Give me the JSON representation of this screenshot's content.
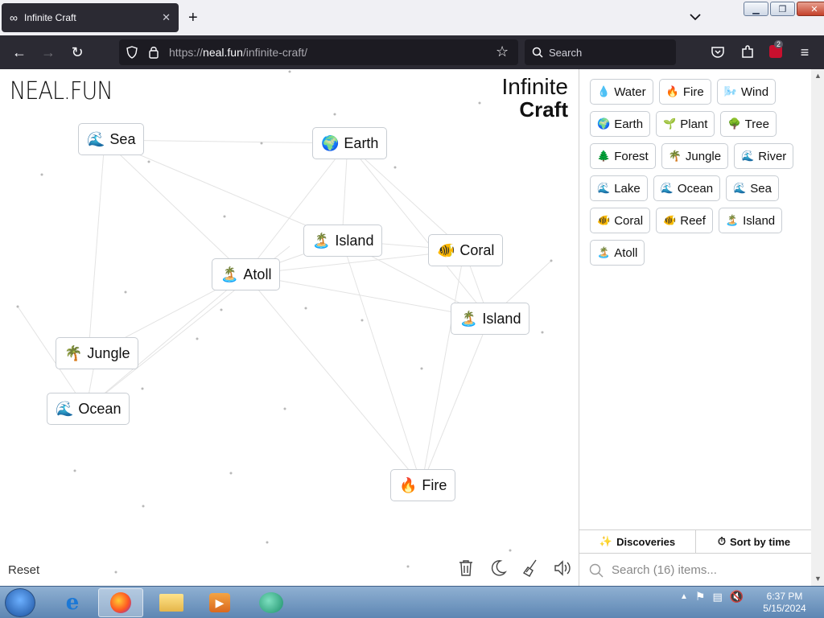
{
  "browser": {
    "tab_title": "Infinite Craft",
    "url_prefix": "https://",
    "url_domain": "neal.fun",
    "url_path": "/infinite-craft/",
    "search_placeholder": "Search",
    "extension_badge": "2"
  },
  "page": {
    "logo": "NEAL.FUN",
    "title_line1": "Infinite",
    "title_line2": "Craft",
    "reset_label": "Reset"
  },
  "canvas_items": [
    {
      "emoji": "🌊",
      "label": "Sea"
    },
    {
      "emoji": "🌍",
      "label": "Earth"
    },
    {
      "emoji": "🏝️",
      "label": "Island"
    },
    {
      "emoji": "🐠",
      "label": "Coral"
    },
    {
      "emoji": "🏝️",
      "label": "Atoll"
    },
    {
      "emoji": "🏝️",
      "label": "Island"
    },
    {
      "emoji": "🌴",
      "label": "Jungle"
    },
    {
      "emoji": "🌊",
      "label": "Ocean"
    },
    {
      "emoji": "🔥",
      "label": "Fire"
    }
  ],
  "sidebar": {
    "items": [
      {
        "emoji": "💧",
        "label": "Water"
      },
      {
        "emoji": "🔥",
        "label": "Fire"
      },
      {
        "emoji": "🌬️",
        "label": "Wind"
      },
      {
        "emoji": "🌍",
        "label": "Earth"
      },
      {
        "emoji": "🌱",
        "label": "Plant"
      },
      {
        "emoji": "🌳",
        "label": "Tree"
      },
      {
        "emoji": "🌲",
        "label": "Forest"
      },
      {
        "emoji": "🌴",
        "label": "Jungle"
      },
      {
        "emoji": "🌊",
        "label": "River"
      },
      {
        "emoji": "🌊",
        "label": "Lake"
      },
      {
        "emoji": "🌊",
        "label": "Ocean"
      },
      {
        "emoji": "🌊",
        "label": "Sea"
      },
      {
        "emoji": "🐠",
        "label": "Coral"
      },
      {
        "emoji": "🐠",
        "label": "Reef"
      },
      {
        "emoji": "🏝️",
        "label": "Island"
      },
      {
        "emoji": "🏝️",
        "label": "Atoll"
      }
    ],
    "discoveries_label": "Discoveries",
    "sort_label": "Sort by time",
    "search_placeholder": "Search (16) items..."
  },
  "taskbar": {
    "time": "6:37 PM",
    "date": "5/15/2024"
  }
}
